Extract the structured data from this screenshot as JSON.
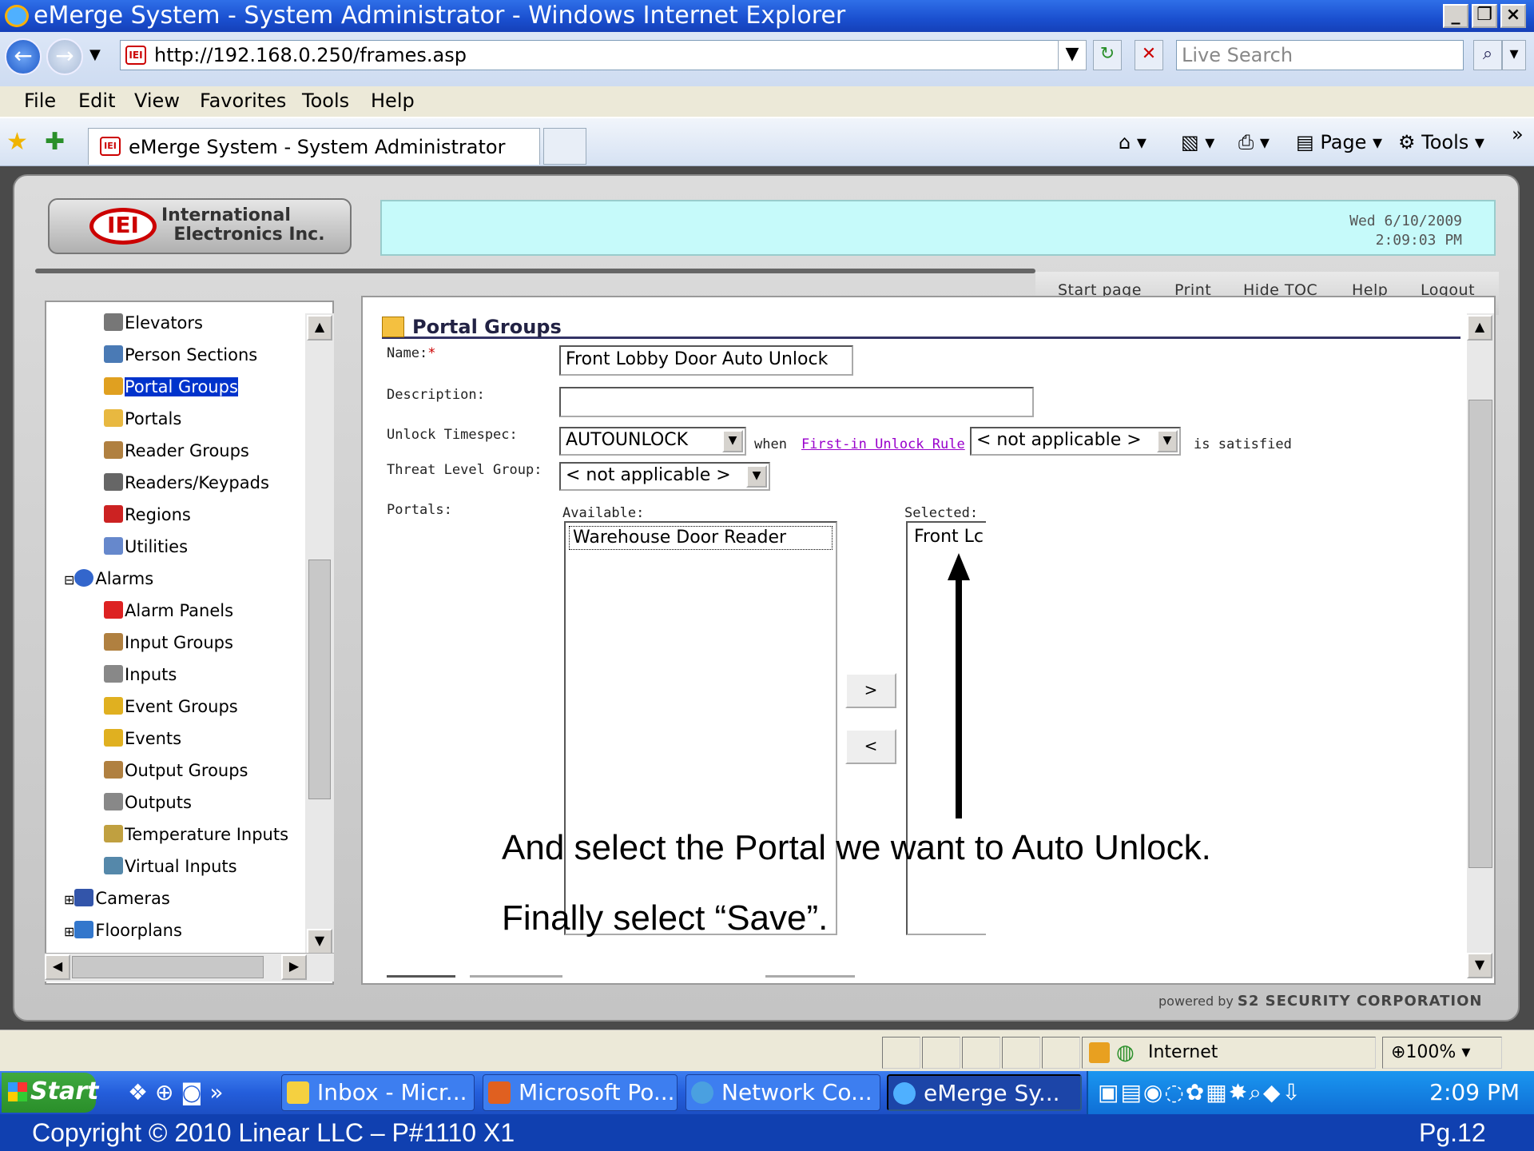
{
  "window": {
    "title": "eMerge System - System Administrator - Windows Internet Explorer",
    "url": "http://192.168.0.250/frames.asp",
    "search_placeholder": "Live Search",
    "menu": [
      "File",
      "Edit",
      "View",
      "Favorites",
      "Tools",
      "Help"
    ],
    "tab_title": "eMerge System - System Administrator",
    "toolbar": {
      "page": "Page",
      "tools": "Tools"
    }
  },
  "app": {
    "logo_text": "International\n  Electronics Inc.",
    "logo_mark": "IEI",
    "date": "Wed 6/10/2009",
    "time": "2:09:03 PM",
    "top_links": [
      "Start page",
      "Print",
      "Hide TOC",
      "Help",
      "Logout"
    ],
    "powered_by": "powered by",
    "powered_brand": "S2 SECURITY CORPORATION"
  },
  "toc": {
    "items": [
      {
        "label": "Elevators",
        "icon": "elevator-icon",
        "color": "#777777"
      },
      {
        "label": "Person Sections",
        "icon": "person-sections-icon",
        "color": "#4a7ab5"
      },
      {
        "label": "Portal Groups",
        "icon": "portal-groups-icon",
        "color": "#e0a020",
        "selected": true
      },
      {
        "label": "Portals",
        "icon": "portal-icon",
        "color": "#e8b840"
      },
      {
        "label": "Reader Groups",
        "icon": "reader-groups-icon",
        "color": "#b08040"
      },
      {
        "label": "Readers/Keypads",
        "icon": "reader-icon",
        "color": "#666666"
      },
      {
        "label": "Regions",
        "icon": "regions-icon",
        "color": "#cc2222"
      },
      {
        "label": "Utilities",
        "icon": "utilities-icon",
        "color": "#6688cc"
      },
      {
        "label": "Alarms",
        "icon": "alarms-icon",
        "color": "#3366cc",
        "group": true
      },
      {
        "label": "Alarm Panels",
        "icon": "alarm-panel-icon",
        "color": "#dd2222"
      },
      {
        "label": "Input Groups",
        "icon": "input-groups-icon",
        "color": "#b08040"
      },
      {
        "label": "Inputs",
        "icon": "inputs-icon",
        "color": "#888888"
      },
      {
        "label": "Event Groups",
        "icon": "event-groups-icon",
        "color": "#e0b020"
      },
      {
        "label": "Events",
        "icon": "events-icon",
        "color": "#e0b020"
      },
      {
        "label": "Output Groups",
        "icon": "output-groups-icon",
        "color": "#b08040"
      },
      {
        "label": "Outputs",
        "icon": "outputs-icon",
        "color": "#888888"
      },
      {
        "label": "Temperature Inputs",
        "icon": "temperature-icon",
        "color": "#c0a040"
      },
      {
        "label": "Virtual Inputs",
        "icon": "virtual-inputs-icon",
        "color": "#5588aa"
      },
      {
        "label": "Cameras",
        "icon": "camera-icon",
        "color": "#3355aa",
        "group": true
      },
      {
        "label": "Floorplans",
        "icon": "floorplan-icon",
        "color": "#3377cc",
        "group": true
      }
    ]
  },
  "form": {
    "title": "Portal Groups",
    "name_label": "Name:",
    "name_required": "*",
    "name_value": "Front Lobby Door Auto Unlock",
    "description_label": "Description:",
    "description_value": "",
    "unlock_label": "Unlock Timespec:",
    "unlock_value": "AUTOUNLOCK",
    "when_text": "when",
    "rule_link": "First-in Unlock Rule",
    "rule_value": "< not applicable >",
    "satisfied_text": "is satisfied",
    "threat_label": "Threat Level Group:",
    "threat_value": "< not applicable >",
    "portals_label": "Portals:",
    "available_label": "Available:",
    "available_items": [
      "Warehouse Door Reader"
    ],
    "selected_label": "Selected:",
    "selected_items": [
      "Front Lc"
    ],
    "add_button": ">",
    "remove_button": "<"
  },
  "annotations": {
    "line1": "And select the Portal we want to Auto Unlock.",
    "line2": "Finally select “Save”."
  },
  "statusbar": {
    "zone": "Internet",
    "zoom": "100%"
  },
  "taskbar": {
    "start": "Start",
    "tasks": [
      "Inbox - Micr...",
      "Microsoft Po...",
      "Network Co...",
      "eMerge Sy..."
    ],
    "clock": "2:09 PM"
  },
  "footer": {
    "copyright": "Copyright  © 2010 Linear LLC – P#1110 X1",
    "page": "Pg.12"
  }
}
